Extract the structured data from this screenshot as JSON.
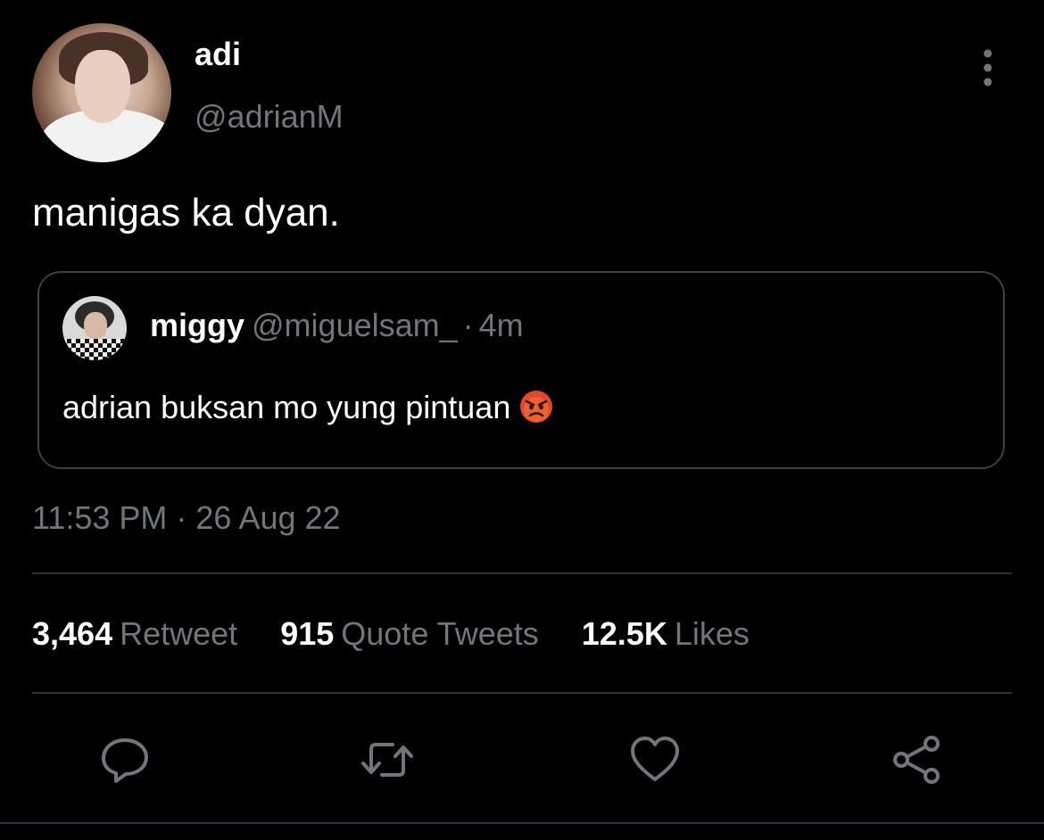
{
  "tweet": {
    "author_name": "adi",
    "author_handle": "@adrianM",
    "text": "manigas ka dyan.",
    "timestamp": "11:53 PM · 26 Aug 22"
  },
  "quoted_tweet": {
    "author_name": "miggy",
    "author_handle": "@miguelsam_",
    "separator": "·",
    "time_ago": "4m",
    "text": "adrian buksan mo yung pintuan",
    "emoji": "angry-face-emoji"
  },
  "stats": [
    {
      "count": "3,464",
      "label": "Retweet"
    },
    {
      "count": "915",
      "label": "Quote Tweets"
    },
    {
      "count": "12.5K",
      "label": "Likes"
    }
  ],
  "actions": [
    "reply-icon",
    "retweet-icon",
    "like-heart-icon",
    "share-icon"
  ],
  "colors": {
    "background": "#000000",
    "primary_text": "#ffffff",
    "secondary_text": "#71767b",
    "divider": "#2f3336",
    "quote_border": "#3e4144"
  }
}
